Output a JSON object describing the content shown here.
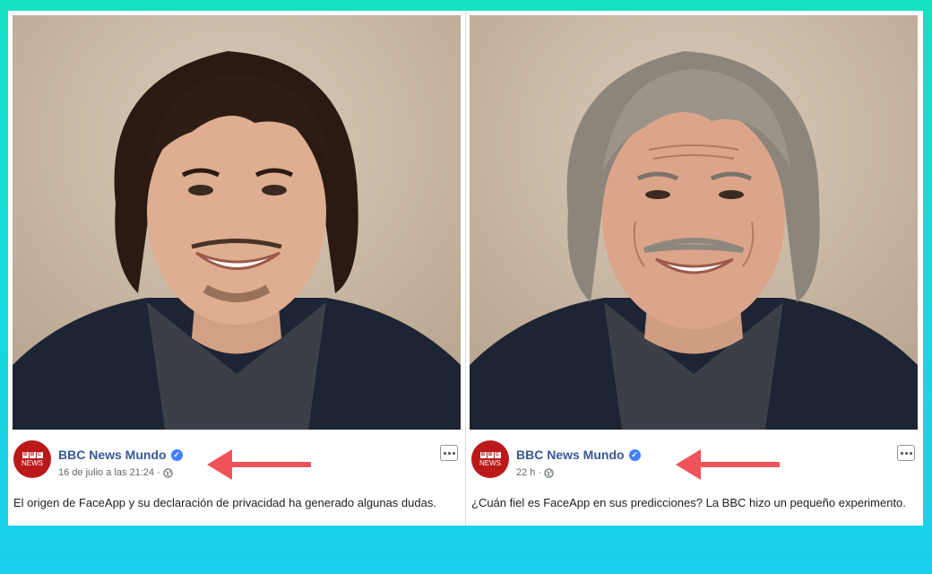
{
  "posts": [
    {
      "page_name": "BBC News Mundo",
      "avatar_logo": "BBC",
      "avatar_text": "NEWS",
      "timestamp": "16 de julio a las 21:24 ·",
      "caption": "El origen de FaceApp y su declaración de privacidad ha generado algunas dudas."
    },
    {
      "page_name": "BBC News Mundo",
      "avatar_logo": "BBC",
      "avatar_text": "NEWS",
      "timestamp": "22 h ·",
      "caption": "¿Cuán fiel es FaceApp en sus predicciones? La BBC hizo un pequeño experimento."
    }
  ],
  "colors": {
    "background_gradient": [
      "#16e0c4",
      "#1ad0ea"
    ],
    "page_name": "#385898",
    "verified_badge": "#4080ff",
    "bbc_red": "#bb1919",
    "arrow": "#f0525a"
  },
  "icons": [
    "verified-badge-icon",
    "globe-icon",
    "more-options-icon",
    "red-arrow-icon"
  ]
}
